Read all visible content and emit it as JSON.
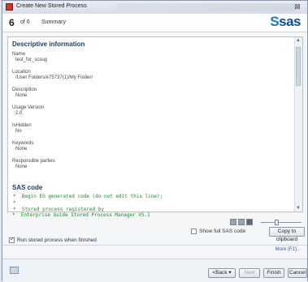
{
  "window": {
    "title": "Create New Stored Process",
    "close_glyph": "⊠"
  },
  "header": {
    "step_number": "6",
    "step_of": "of 6",
    "step_title": "Summary",
    "logo_text": "sas"
  },
  "descriptive": {
    "title": "Descriptive information",
    "fields": [
      {
        "label": "Name",
        "value": "test_for_scsug"
      },
      {
        "label": "Location",
        "value": "/User Folders/e75737(1)/My Folder/"
      },
      {
        "label": "Description",
        "value": "None"
      },
      {
        "label": "Usage Version",
        "value": "2.0"
      },
      {
        "label": "IsHidden",
        "value": "No"
      },
      {
        "label": "Keywords",
        "value": "None"
      },
      {
        "label": "Responsible parties",
        "value": "None"
      }
    ]
  },
  "code": {
    "title": "SAS code",
    "lines": [
      "*  Begin EG generated code (do not edit this line);",
      "*",
      "*  Stored process registered by",
      "*  Enterprise Guide Stored Process Manager V5.1"
    ]
  },
  "options": {
    "show_full_sas_code_label": "Show full SAS code",
    "copy_label": "Copy to clipboard",
    "run_label": "Run stored process when finished",
    "more_link": "More (F1)..."
  },
  "footer": {
    "back_label": "<Back ▾",
    "next_label": "Next",
    "finish_label": "Finish",
    "cancel_label": "Cancel"
  }
}
